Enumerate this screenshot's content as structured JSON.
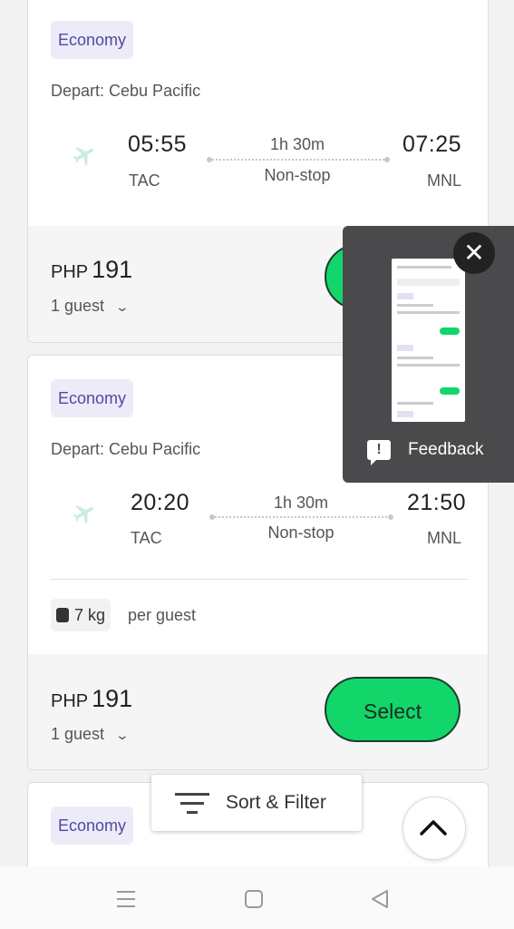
{
  "flights": [
    {
      "cabin": "Economy",
      "depart": "Depart: Cebu Pacific",
      "dep_time": "05:55",
      "arr_time": "07:25",
      "duration": "1h 30m",
      "stops": "Non-stop",
      "origin": "TAC",
      "destination": "MNL",
      "currency": "PHP",
      "price": "191",
      "guests": "1 guest"
    },
    {
      "cabin": "Economy",
      "depart": "Depart: Cebu Pacific",
      "dep_time": "20:20",
      "arr_time": "21:50",
      "duration": "1h 30m",
      "stops": "Non-stop",
      "origin": "TAC",
      "destination": "MNL",
      "baggage": "7 kg",
      "baggage_unit": "per guest",
      "currency": "PHP",
      "price": "191",
      "guests": "1 guest",
      "select_label": "Select"
    },
    {
      "cabin": "Economy"
    }
  ],
  "feedback": {
    "label": "Feedback",
    "close_symbol": "✕"
  },
  "sort_filter": {
    "label": "Sort & Filter"
  },
  "icons": {
    "plane": "plane-icon",
    "chevron": "chevron-down-icon",
    "scroll_up": "chevron-up-icon",
    "luggage": "luggage-icon",
    "feedback": "feedback-icon",
    "menu": "menu-icon",
    "home": "home-icon",
    "back": "back-icon"
  },
  "colors": {
    "select_green": "#12d66a",
    "badge_bg": "#ecebf7",
    "badge_text": "#4f4aa3",
    "feedback_bg": "#4a4a4d"
  }
}
